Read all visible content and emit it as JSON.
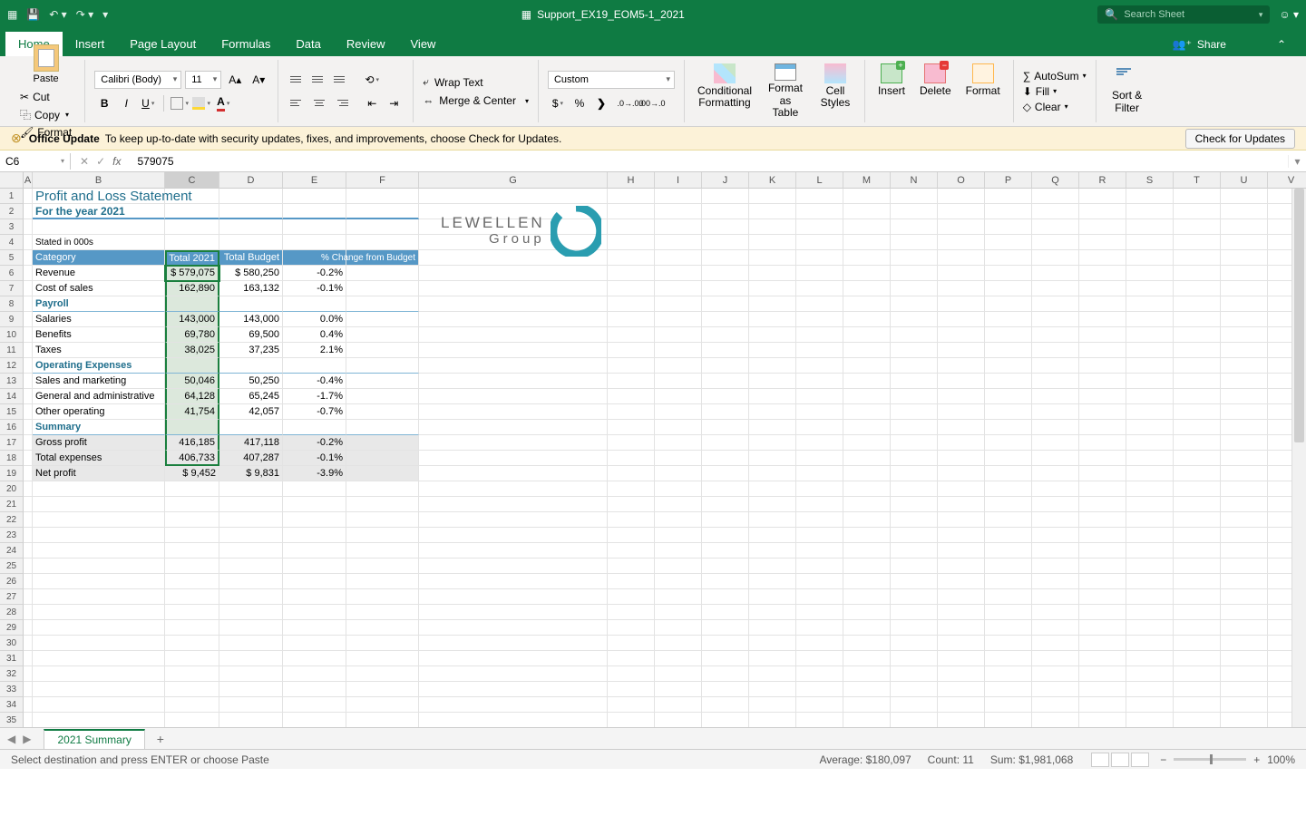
{
  "titlebar": {
    "filename": "Support_EX19_EOM5-1_2021",
    "search_placeholder": "Search Sheet"
  },
  "tabs": {
    "items": [
      "Home",
      "Insert",
      "Page Layout",
      "Formulas",
      "Data",
      "Review",
      "View"
    ],
    "share": "Share"
  },
  "ribbon": {
    "paste": "Paste",
    "cut": "Cut",
    "copy": "Copy",
    "format": "Format",
    "font_name": "Calibri (Body)",
    "font_size": "11",
    "wrap": "Wrap Text",
    "merge": "Merge & Center",
    "num_format": "Custom",
    "cond_fmt": "Conditional Formatting",
    "fmt_table": "Format as Table",
    "cell_styles": "Cell Styles",
    "insert": "Insert",
    "delete": "Delete",
    "format_cells": "Format",
    "autosum": "AutoSum",
    "fill": "Fill",
    "clear": "Clear",
    "sort": "Sort & Filter"
  },
  "update_bar": {
    "title": "Office Update",
    "msg": "To keep up-to-date with security updates, fixes, and improvements, choose Check for Updates.",
    "btn": "Check for Updates"
  },
  "formula": {
    "cell_ref": "C6",
    "value": "579075"
  },
  "columns": [
    "A",
    "B",
    "C",
    "D",
    "E",
    "F",
    "G",
    "H",
    "I",
    "J",
    "K",
    "L",
    "M",
    "N",
    "O",
    "P",
    "Q",
    "R",
    "S",
    "T",
    "U",
    "V"
  ],
  "col_widths": {
    "A": 10,
    "B": 146,
    "C": 60,
    "D": 70,
    "E": 70,
    "F": 80,
    "G": 208,
    "std": 52
  },
  "sheet": {
    "title": "Profit and Loss Statement",
    "subtitle": "For the year 2021",
    "stated": "Stated in 000s",
    "headers": {
      "cat": "Category",
      "c": "Total 2021",
      "d": "Total Budget",
      "e": "% Change from Budget"
    },
    "rows": [
      {
        "b": "Revenue",
        "c": "$  579,075",
        "d": "$       580,250",
        "e": "-0.2%"
      },
      {
        "b": "Cost of sales",
        "c": "162,890",
        "d": "163,132",
        "e": "-0.1%"
      },
      {
        "section": "Payroll"
      },
      {
        "b": "Salaries",
        "c": "143,000",
        "d": "143,000",
        "e": "0.0%"
      },
      {
        "b": "Benefits",
        "c": "69,780",
        "d": "69,500",
        "e": "0.4%"
      },
      {
        "b": "Taxes",
        "c": "38,025",
        "d": "37,235",
        "e": "2.1%"
      },
      {
        "section": "Operating Expenses"
      },
      {
        "b": "Sales and marketing",
        "c": "50,046",
        "d": "50,250",
        "e": "-0.4%"
      },
      {
        "b": "General and administrative",
        "c": "64,128",
        "d": "65,245",
        "e": "-1.7%"
      },
      {
        "b": "Other operating",
        "c": "41,754",
        "d": "42,057",
        "e": "-0.7%"
      },
      {
        "section": "Summary"
      },
      {
        "b": "Gross profit",
        "c": "416,185",
        "d": "417,118",
        "e": "-0.2%",
        "sum": true
      },
      {
        "b": "Total expenses",
        "c": "406,733",
        "d": "407,287",
        "e": "-0.1%",
        "sum": true
      },
      {
        "b": "Net profit",
        "c": "$       9,452",
        "d": "$           9,831",
        "e": "-3.9%",
        "sum": true
      }
    ],
    "logo": {
      "l1": "LEWELLEN",
      "l2": "Group"
    }
  },
  "sheet_tabs": {
    "active": "2021 Summary"
  },
  "status": {
    "msg": "Select destination and press ENTER or choose Paste",
    "avg_label": "Average:",
    "avg": "$180,097",
    "count_label": "Count:",
    "count": "11",
    "sum_label": "Sum:",
    "sum": "$1,981,068",
    "zoom": "100%"
  }
}
